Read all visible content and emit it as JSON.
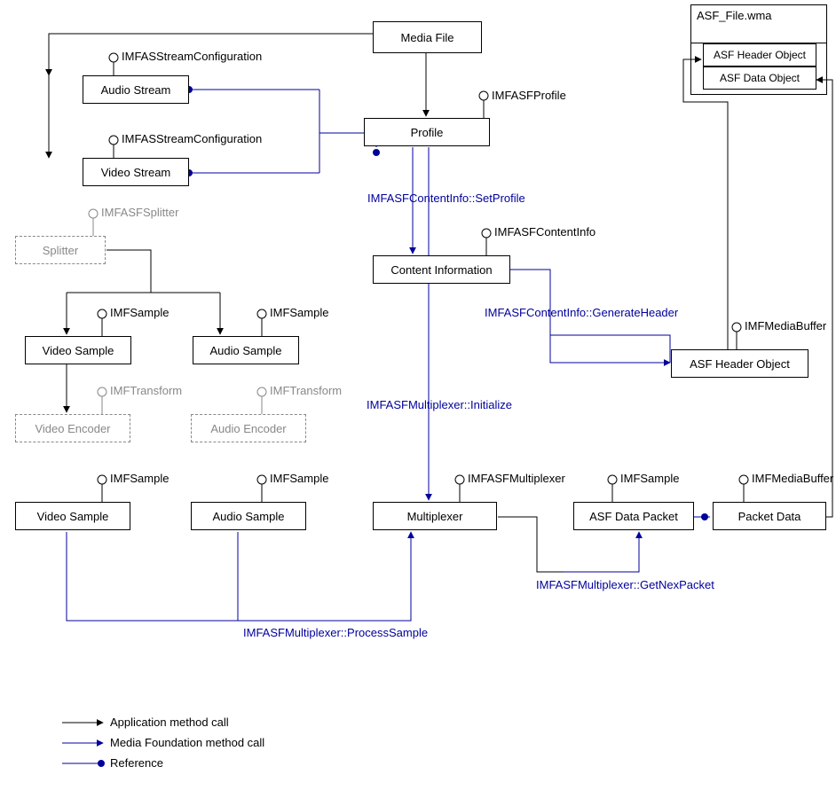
{
  "boxes": {
    "media_file": "Media File",
    "audio_stream": "Audio Stream",
    "video_stream": "Video Stream",
    "profile": "Profile",
    "splitter": "Splitter",
    "video_sample1": "Video Sample",
    "audio_sample1": "Audio Sample",
    "video_encoder": "Video Encoder",
    "audio_encoder": "Audio Encoder",
    "video_sample2": "Video Sample",
    "audio_sample2": "Audio Sample",
    "multiplexer": "Multiplexer",
    "content_info": "Content Information",
    "asf_header_object": "ASF Header Object",
    "asf_data_packet": "ASF Data Packet",
    "packet_data": "Packet Data",
    "asf_file_title": "ASF_File.wma",
    "asf_file_row1": "ASF Header Object",
    "asf_file_row2": "ASF Data Object"
  },
  "interfaces": {
    "audio_stream_config": "IMFASStreamConfiguration",
    "video_stream_config": "IMFASStreamConfiguration",
    "profile": "IMFASFProfile",
    "splitter": "IMFASFSplitter",
    "video_sample1": "IMFSample",
    "audio_sample1": "IMFSample",
    "video_encoder": "IMFTransform",
    "audio_encoder": "IMFTransform",
    "video_sample2": "IMFSample",
    "audio_sample2": "IMFSample",
    "multiplexer": "IMFASFMultiplexer",
    "content_info": "IMFASFContentInfo",
    "asf_header_object_buf": "IMFMediaBuffer",
    "asf_data_packet": "IMFSample",
    "packet_data_buf": "IMFMediaBuffer"
  },
  "calls": {
    "set_profile": "IMFASFContentInfo::SetProfile",
    "generate_header": "IMFASFContentInfo::GenerateHeader",
    "mux_initialize": "IMFASFMultiplexer::Initialize",
    "mux_process_sample": "IMFASFMultiplexer::ProcessSample",
    "mux_get_next_packet": "IMFASFMultiplexer::GetNexPacket"
  },
  "legend": {
    "app_call": "Application method call",
    "mf_call": "Media Foundation method call",
    "reference": "Reference"
  }
}
